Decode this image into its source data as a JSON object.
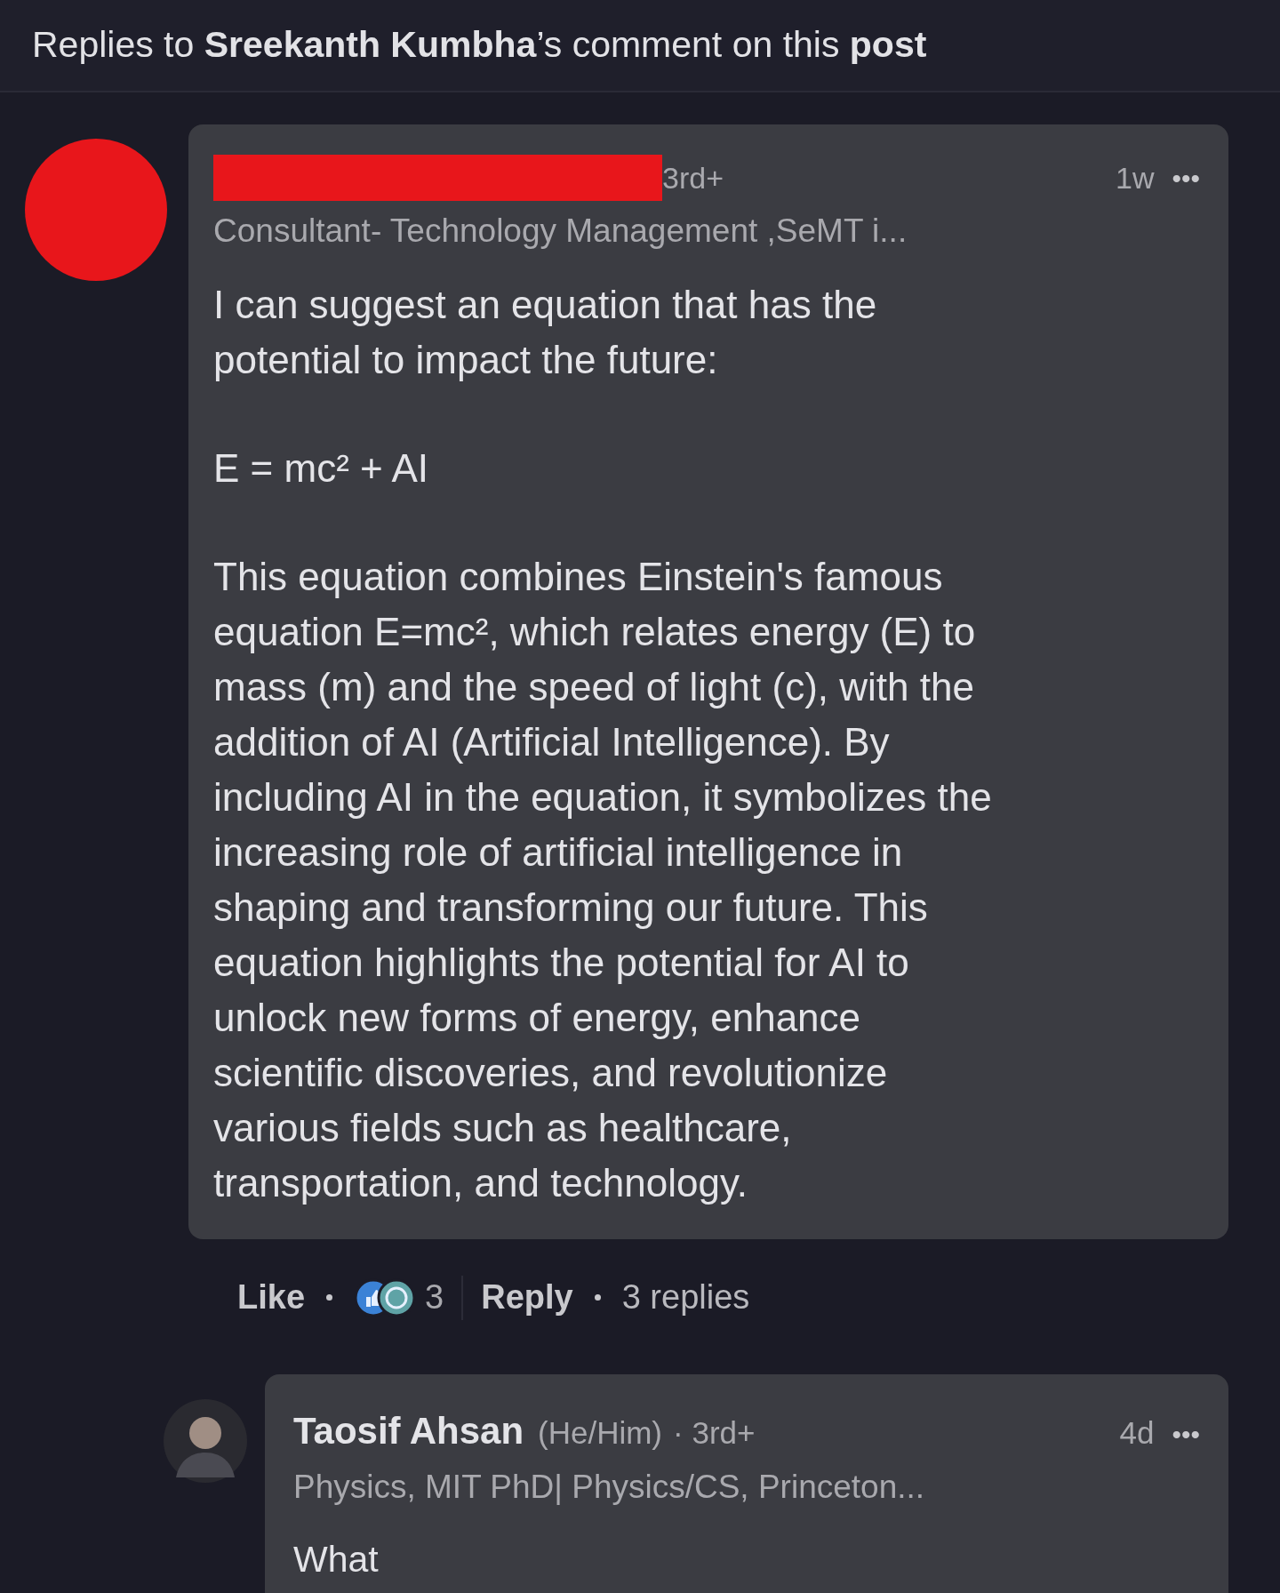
{
  "header": {
    "title": "Replies to **Sreekanth Kumbha**’s comment on this **post**"
  },
  "comment": {
    "redacted_name": true,
    "degree": "3rd+",
    "time": "1w",
    "more": "•••",
    "headline": "Consultant- Technology Management ,SeMT i...",
    "body": [
      "I can suggest an equation that has the\npotential to impact the future:",
      "E = mc² + AI",
      "This equation combines Einstein's famous\nequation E=mc², which relates energy (E) to\nmass (m) and the speed of light (c), with the\naddition of AI (Artificial Intelligence). By\nincluding AI in the equation, it symbolizes the\nincreasing role of artificial intelligence in\nshaping and transforming our future. This\nequation highlights the potential for AI to\nunlock new forms of energy, enhance\nscientific discoveries, and revolutionize\nvarious fields such as healthcare,\ntransportation, and technology."
    ],
    "actions": {
      "like": "Like",
      "reaction_count": "3",
      "reply": "Reply",
      "replies": "3 replies"
    }
  },
  "reply": {
    "name": "Taosif Ahsan",
    "pronouns": "(He/Him)",
    "degree": "· 3rd+",
    "time": "4d",
    "more": "•••",
    "headline": "Physics, MIT PhD| Physics/CS, Princeton...",
    "body": "What"
  }
}
